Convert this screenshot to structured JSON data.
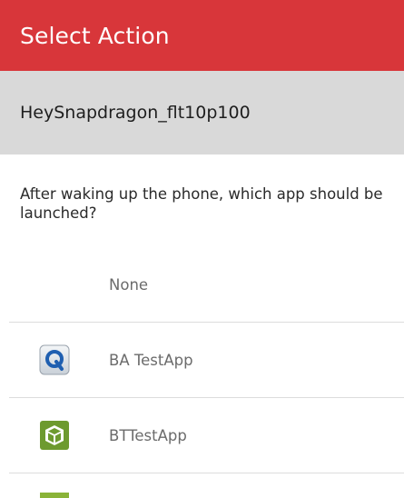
{
  "header": {
    "title": "Select Action"
  },
  "subheader": {
    "label": "HeySnapdragon_flt10p100"
  },
  "prompt": {
    "text": "After waking up the phone, which app should be launched?"
  },
  "options": [
    {
      "label": "None",
      "icon": "none"
    },
    {
      "label": "BA TestApp",
      "icon": "q-logo-icon"
    },
    {
      "label": "BTTestApp",
      "icon": "cube-app-icon"
    },
    {
      "label": "",
      "icon": "green-app-icon"
    }
  ],
  "colors": {
    "header_bg": "#d8363a",
    "subheader_bg": "#d9d9d9",
    "q_icon_blue": "#1f5fb0",
    "cube_icon_green": "#6d9a2f"
  }
}
